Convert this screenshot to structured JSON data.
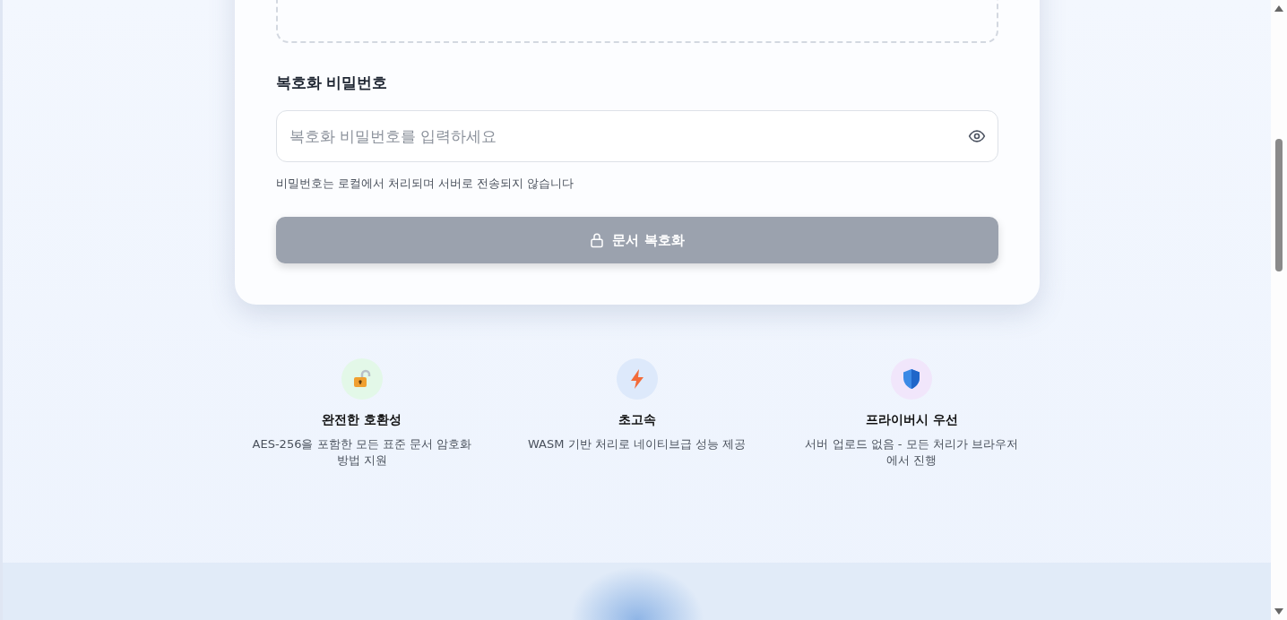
{
  "password": {
    "label": "복호화 비밀번호",
    "placeholder": "복호화 비밀번호를 입력하세요",
    "hint": "비밀번호는 로컬에서 처리되며 서버로 전송되지 않습니다"
  },
  "decrypt_button": {
    "label": "문서 복호화",
    "disabled": true
  },
  "features": [
    {
      "kind": "lock",
      "color": "#e3f8e8",
      "title": "완전한 호환성",
      "text": "AES-256을 포함한 모든 표준 문서 암호화 방법 지원"
    },
    {
      "kind": "bolt",
      "color": "#dde9fb",
      "title": "초고속",
      "text": "WASM 기반 처리로 네이티브급 성능 제공"
    },
    {
      "kind": "shield",
      "color": "#f1e6fb",
      "title": "프라이버시 우선",
      "text": "서버 업로드 없음 - 모든 처리가 브라우저에서 진행"
    }
  ]
}
